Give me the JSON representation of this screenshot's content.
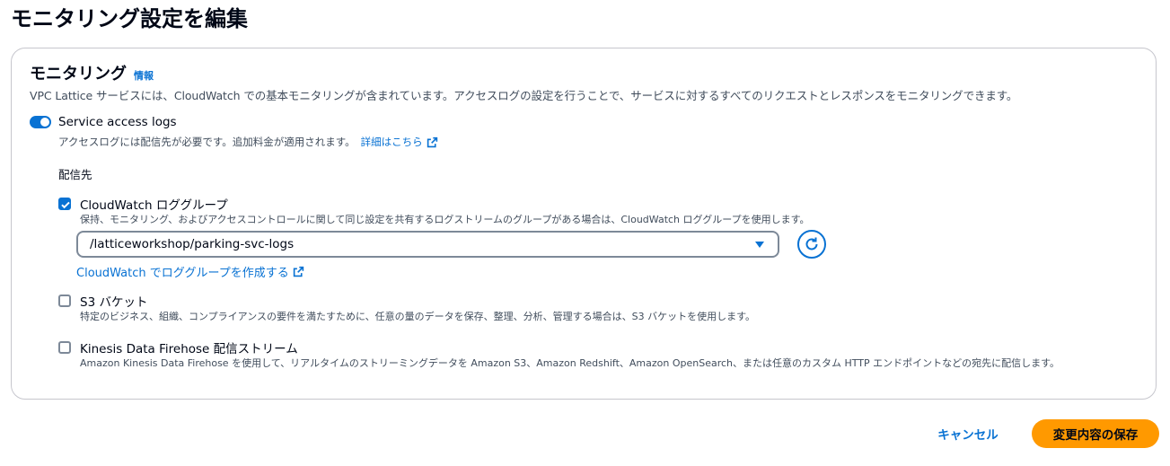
{
  "page": {
    "title": "モニタリング設定を編集"
  },
  "section": {
    "title": "モニタリング",
    "info_link": "情報",
    "description": "VPC Lattice サービスには、CloudWatch での基本モニタリングが含まれています。アクセスログの設定を行うことで、サービスに対するすべてのリクエストとレスポンスをモニタリングできます。"
  },
  "access_logs": {
    "label": "Service access logs",
    "enabled": true,
    "description": "アクセスログには配信先が必要です。追加料金が適用されます。",
    "details_link": "詳細はこちら"
  },
  "destination": {
    "label": "配信先",
    "options": [
      {
        "label": "CloudWatch ロググループ",
        "checked": true,
        "description": "保持、モニタリング、およびアクセスコントロールに関して同じ設定を共有するログストリームのグループがある場合は、CloudWatch ロググループを使用します。"
      },
      {
        "label": "S3 バケット",
        "checked": false,
        "description": "特定のビジネス、組織、コンプライアンスの要件を満たすために、任意の量のデータを保存、整理、分析、管理する場合は、S3 バケットを使用します。"
      },
      {
        "label": "Kinesis Data Firehose 配信ストリーム",
        "checked": false,
        "description": "Amazon Kinesis Data Firehose を使用して、リアルタイムのストリーミングデータを Amazon S3、Amazon Redshift、Amazon OpenSearch、または任意のカスタム HTTP エンドポイントなどの宛先に配信します。"
      }
    ],
    "log_group_select": {
      "value": "/latticeworkshop/parking-svc-logs"
    },
    "create_link": "CloudWatch でロググループを作成する"
  },
  "footer": {
    "cancel_label": "キャンセル",
    "save_label": "変更内容の保存"
  },
  "colors": {
    "accent": "#0972d3",
    "primary_button": "#ff9900",
    "text": "#000716",
    "secondary_text": "#414d5c",
    "border": "#7d8998"
  },
  "icons": [
    "external-link-icon",
    "caret-down-icon",
    "refresh-icon",
    "checkmark-icon"
  ]
}
